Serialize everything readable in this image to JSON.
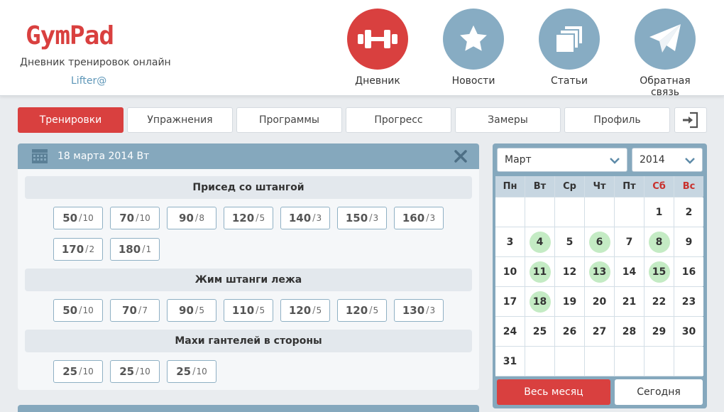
{
  "header": {
    "logo": "GymPad",
    "tagline": "Дневник тренировок онлайн",
    "username": "Lifter@",
    "nav": [
      {
        "label": "Дневник",
        "icon": "dumbbell-icon",
        "active": true
      },
      {
        "label": "Новости",
        "icon": "star-icon",
        "active": false
      },
      {
        "label": "Статьи",
        "icon": "pages-icon",
        "active": false
      },
      {
        "label": "Обратная связь",
        "icon": "paper-plane-icon",
        "active": false
      }
    ]
  },
  "tabs": [
    "Тренировки",
    "Упражнения",
    "Программы",
    "Прогресс",
    "Замеры",
    "Профиль"
  ],
  "active_tab": "Тренировки",
  "workout": {
    "date": "18 марта 2014 Вт",
    "exercises": [
      {
        "name": "Присед со штангой",
        "sets": [
          {
            "weight": "50",
            "reps": "10"
          },
          {
            "weight": "70",
            "reps": "10"
          },
          {
            "weight": "90",
            "reps": "8"
          },
          {
            "weight": "120",
            "reps": "5"
          },
          {
            "weight": "140",
            "reps": "3"
          },
          {
            "weight": "150",
            "reps": "3"
          },
          {
            "weight": "160",
            "reps": "3"
          },
          {
            "weight": "170",
            "reps": "2"
          },
          {
            "weight": "180",
            "reps": "1"
          }
        ]
      },
      {
        "name": "Жим штанги лежа",
        "sets": [
          {
            "weight": "50",
            "reps": "10"
          },
          {
            "weight": "70",
            "reps": "7"
          },
          {
            "weight": "90",
            "reps": "5"
          },
          {
            "weight": "110",
            "reps": "5"
          },
          {
            "weight": "120",
            "reps": "5"
          },
          {
            "weight": "120",
            "reps": "5"
          },
          {
            "weight": "130",
            "reps": "3"
          }
        ]
      },
      {
        "name": "Махи гантелей в стороны",
        "sets": [
          {
            "weight": "25",
            "reps": "10"
          },
          {
            "weight": "25",
            "reps": "10"
          },
          {
            "weight": "25",
            "reps": "10"
          }
        ]
      }
    ]
  },
  "calendar": {
    "month": "Март",
    "year": "2014",
    "weekdays": [
      "Пн",
      "Вт",
      "Ср",
      "Чт",
      "Пт",
      "Сб",
      "Вс"
    ],
    "weeks": [
      [
        "",
        "",
        "",
        "",
        "",
        "1",
        "2"
      ],
      [
        "3",
        "4",
        "5",
        "6",
        "7",
        "8",
        "9"
      ],
      [
        "10",
        "11",
        "12",
        "13",
        "14",
        "15",
        "16"
      ],
      [
        "17",
        "18",
        "19",
        "20",
        "21",
        "22",
        "23"
      ],
      [
        "24",
        "25",
        "26",
        "27",
        "28",
        "29",
        "30"
      ],
      [
        "31",
        "",
        "",
        "",
        "",
        "",
        ""
      ]
    ],
    "workout_days": [
      "4",
      "6",
      "8",
      "11",
      "13",
      "15",
      "18"
    ],
    "whole_month_label": "Весь месяц",
    "today_label": "Сегодня"
  },
  "colors": {
    "accent": "#d9403f",
    "nav_circle": "#87acc3",
    "panel_header": "#85a8bd",
    "workout_day": "#c4ebc4",
    "weekend_text": "#c9302c"
  }
}
